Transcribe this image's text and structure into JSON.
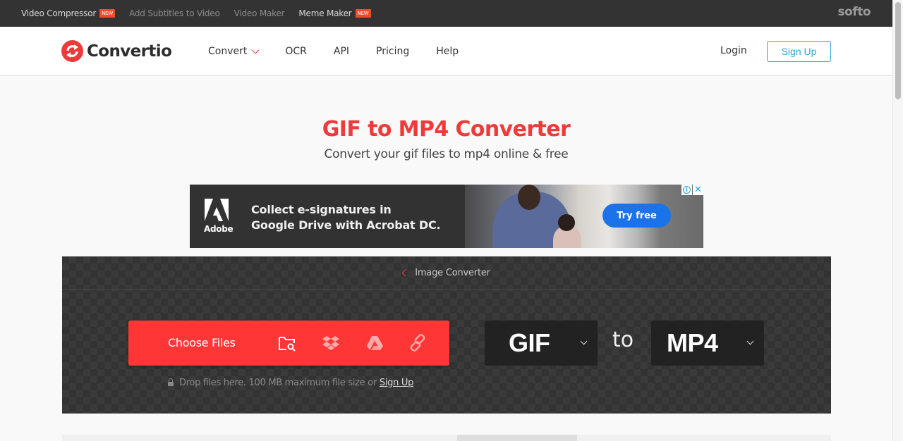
{
  "topbar": {
    "links": [
      {
        "label": "Video Compressor",
        "badge": "NEW"
      },
      {
        "label": "Add Subtitles to Video",
        "badge": null
      },
      {
        "label": "Video Maker",
        "badge": null
      },
      {
        "label": "Meme Maker",
        "badge": "NEW"
      }
    ],
    "brand": "softo"
  },
  "header": {
    "logo_text": "Convertio",
    "nav": [
      {
        "label": "Convert",
        "has_dropdown": true
      },
      {
        "label": "OCR"
      },
      {
        "label": "API"
      },
      {
        "label": "Pricing"
      },
      {
        "label": "Help"
      }
    ],
    "login_label": "Login",
    "signup_label": "Sign Up"
  },
  "hero": {
    "title": "GIF to MP4 Converter",
    "subtitle": "Convert your gif files to mp4 online & free"
  },
  "ad": {
    "brand": "Adobe",
    "headline_line1": "Collect e-signatures in",
    "headline_line2": "Google Drive with Acrobat DC.",
    "cta": "Try free",
    "info_icon": "i",
    "close_icon": "✕"
  },
  "converter": {
    "back_label": "Image Converter",
    "choose_files_label": "Choose Files",
    "sources": [
      "folder-search-icon",
      "dropbox-icon",
      "google-drive-icon",
      "link-icon"
    ],
    "drop_note": "Drop files here. 100 MB maximum file size or",
    "drop_signup": "Sign Up",
    "from_format": "GIF",
    "to_word": "to",
    "to_format": "MP4"
  },
  "colors": {
    "accent": "#ef3a3a",
    "button_red": "#ff3636",
    "signup_blue": "#29a8d8",
    "topbar_bg": "#333333",
    "ad_cta_blue": "#1a73e8"
  }
}
